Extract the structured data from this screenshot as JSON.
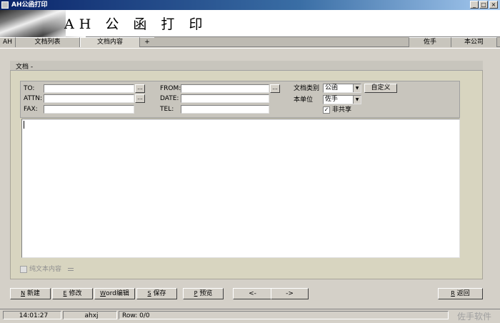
{
  "window": {
    "title": "AH公函打印",
    "controls": {
      "minimize": "_",
      "maximize": "□",
      "close": "×"
    }
  },
  "banner": {
    "logo_text": "AH 公 函 打 印"
  },
  "tabs": {
    "left": [
      {
        "label": "AH"
      },
      {
        "label": "文档列表"
      },
      {
        "label": "文档内容"
      },
      {
        "label": "+"
      }
    ],
    "right": [
      {
        "label": "佐手"
      },
      {
        "label": "本公司"
      }
    ]
  },
  "panel": {
    "title": "文档 -"
  },
  "form": {
    "to_label": "TO:",
    "attn_label": "ATTN:",
    "fax_label": "FAX:",
    "from_label": "FROM:",
    "date_label": "DATE:",
    "tel_label": "TEL:",
    "to_value": "",
    "attn_value": "",
    "fax_value": "",
    "from_value": "",
    "date_value": "",
    "tel_value": "",
    "browse_label": "...",
    "doc_type_label": "文档类别",
    "doc_type_value": "公函",
    "custom_button": "自定义",
    "unit_label": "本单位",
    "unit_value": "佐手",
    "non_shared_label": "非共享",
    "non_shared_checked": "✓"
  },
  "editor": {
    "content": ""
  },
  "plain_text": {
    "label": "纯文本内容"
  },
  "buttons": [
    {
      "key": "N",
      "label": "新建"
    },
    {
      "key": "E",
      "label": "修改"
    },
    {
      "key": "W",
      "label": "ord编辑"
    },
    {
      "key": "S",
      "label": "保存"
    },
    {
      "key": "P",
      "label": "预览"
    },
    {
      "key": "",
      "label": "<-"
    },
    {
      "key": "",
      "label": "->"
    },
    {
      "key": "R",
      "label": "返回"
    }
  ],
  "status": {
    "time": "14:01:27",
    "user": "ahxj",
    "row": "Row: 0/0",
    "brand": "佐手软件"
  }
}
